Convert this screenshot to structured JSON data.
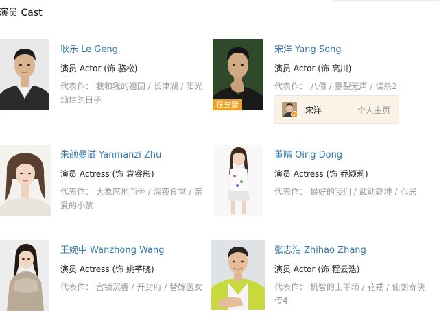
{
  "section": {
    "title": "演员 Cast"
  },
  "cast": [
    {
      "name": "耿乐 Le Geng",
      "role": "演员 Actor (饰 骆松)",
      "works_label": "代表作：",
      "works": "我和我的祖国 / 长津湖 / 阳光灿烂的日子"
    },
    {
      "name": "宋洋 Yang Song",
      "role": "演员 Actor (饰 高川)",
      "works_label": "代表作：",
      "works": "八佰 / 暴裂无声 / 误杀2",
      "badge": "在豆瓣",
      "account": {
        "name": "宋洋",
        "link": "个人主页"
      }
    },
    {
      "name": "朱颜曼滋 Yanmanzi Zhu",
      "role": "演员 Actress (饰 袁睿彤)",
      "works_label": "代表作：",
      "works": "大象席地而坐 / 深夜食堂 / 亲爱的小孩"
    },
    {
      "name": "董晴 Qing Dong",
      "role": "演员 Actress (饰 乔颖莉)",
      "works_label": "代表作：",
      "works": "最好的我们 / 武动乾坤 / 心居"
    },
    {
      "name": "王婉中 Wanzhong Wang",
      "role": "演员 Actress (饰 姚芊晓)",
      "works_label": "代表作：",
      "works": "宫锁沉香 / 开封府 / 替嫁医女"
    },
    {
      "name": "张志浩 Zhihao Zhang",
      "role": "演员 Actor (饰 程云浩)",
      "works_label": "代表作：",
      "works": "机智的上半场 / 花戎 / 仙剑奇侠传4"
    }
  ],
  "colors": {
    "link": "#3377aa",
    "muted": "#999999",
    "badge": "#f0a020",
    "account_bg": "#fbf3e8"
  }
}
